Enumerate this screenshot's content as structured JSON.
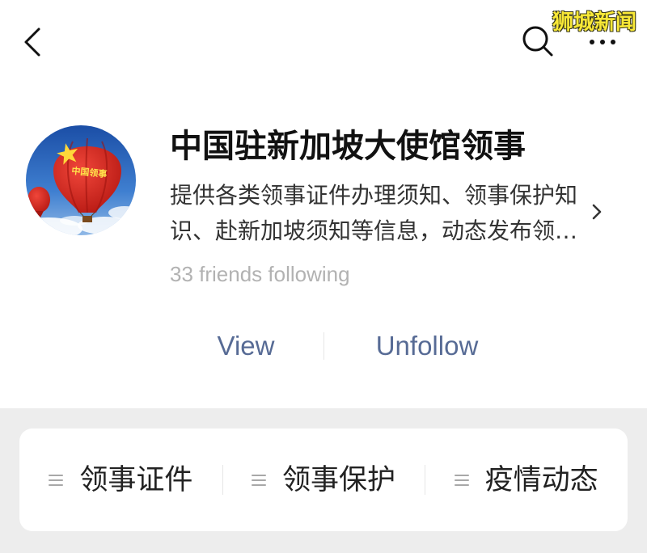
{
  "topbar": {
    "back_icon": "chevron-left-icon",
    "search_icon": "search-icon",
    "more_icon": "more-icon"
  },
  "watermark": "狮城新闻",
  "account": {
    "avatar_logo_text": "中国领事",
    "name": "中国驻新加坡大使馆领事",
    "description_lines": [
      "提供各类领事证件办理须知、领事保护知",
      "识、赴新加坡须知等信息，动态发布领…"
    ],
    "description_chevron_icon": "chevron-right-icon",
    "friends_following": "33 friends following"
  },
  "actions": {
    "view_label": "View",
    "unfollow_label": "Unfollow"
  },
  "menu": {
    "items": [
      {
        "label": "领事证件",
        "icon": "menu-lines-icon"
      },
      {
        "label": "领事保护",
        "icon": "menu-lines-icon"
      },
      {
        "label": "疫情动态",
        "icon": "menu-lines-icon"
      }
    ]
  },
  "colors": {
    "link": "#576b95",
    "watermark": "#f8e837",
    "background": "#ededed",
    "card": "#ffffff",
    "secondary_text": "#b2b2b2"
  }
}
